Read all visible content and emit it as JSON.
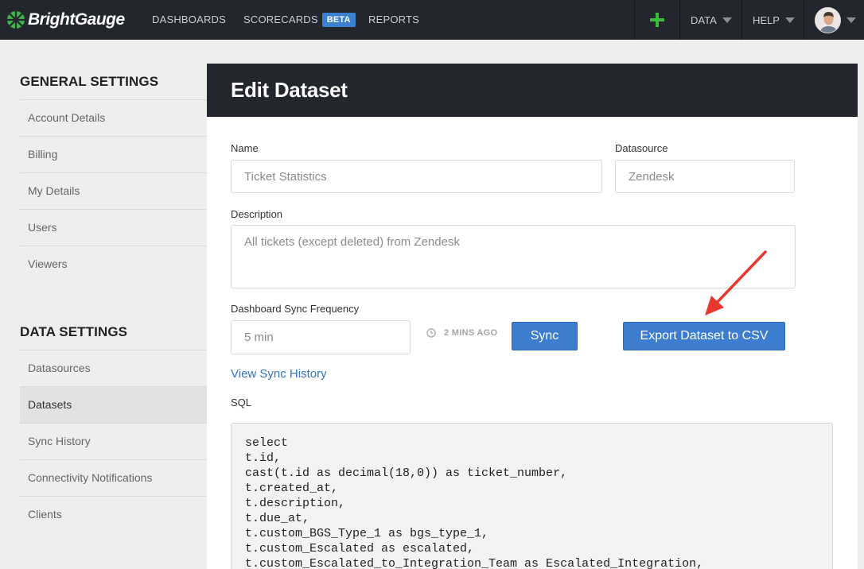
{
  "brand": {
    "name": "BrightGauge"
  },
  "nav": {
    "dashboards": "DASHBOARDS",
    "scorecards": "SCORECARDS",
    "beta_badge": "BETA",
    "reports": "REPORTS",
    "data_menu": "DATA",
    "help_menu": "HELP"
  },
  "sidebar": {
    "general_heading": "GENERAL SETTINGS",
    "general_items": [
      {
        "label": "Account Details"
      },
      {
        "label": "Billing"
      },
      {
        "label": "My Details"
      },
      {
        "label": "Users"
      },
      {
        "label": "Viewers"
      }
    ],
    "data_heading": "DATA SETTINGS",
    "data_items": [
      {
        "label": "Datasources"
      },
      {
        "label": "Datasets",
        "active": true
      },
      {
        "label": "Sync History"
      },
      {
        "label": "Connectivity Notifications"
      },
      {
        "label": "Clients"
      }
    ]
  },
  "page": {
    "title": "Edit Dataset",
    "name_label": "Name",
    "name_value": "Ticket Statistics",
    "datasource_label": "Datasource",
    "datasource_value": "Zendesk",
    "description_label": "Description",
    "description_value": "All tickets (except deleted) from Zendesk",
    "sync_frequency_label": "Dashboard Sync Frequency",
    "sync_frequency_value": "5 min",
    "last_sync": "2 MINS AGO",
    "sync_button": "Sync",
    "export_button": "Export Dataset to CSV",
    "sync_history_link": "View Sync History",
    "sql_label": "SQL",
    "sql_lines": [
      "select",
      "t.id,",
      "cast(t.id as decimal(18,0)) as ticket_number,",
      "t.created_at,",
      "t.description,",
      "t.due_at,",
      "t.custom_BGS_Type_1 as bgs_type_1,",
      "t.custom_Escalated as escalated,",
      "t.custom_Escalated_to_Integration_Team as Escalated_Integration,"
    ]
  },
  "colors": {
    "navbar": "#24262d",
    "primary_button": "#3c7dd0",
    "link": "#2f73c7",
    "annotation_arrow": "#e8372c",
    "add_icon": "#3dbb3d"
  }
}
